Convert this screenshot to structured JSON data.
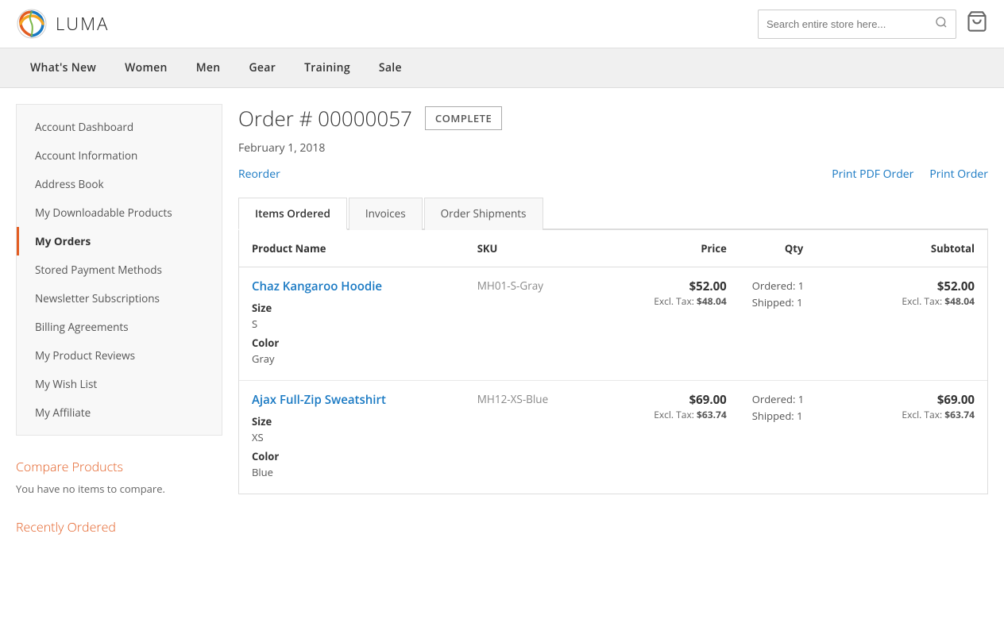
{
  "header": {
    "logo_text": "LUMA",
    "search_placeholder": "Search entire store here...",
    "cart_label": "Cart"
  },
  "nav": {
    "items": [
      {
        "label": "What's New",
        "id": "whats-new"
      },
      {
        "label": "Women",
        "id": "women"
      },
      {
        "label": "Men",
        "id": "men"
      },
      {
        "label": "Gear",
        "id": "gear"
      },
      {
        "label": "Training",
        "id": "training"
      },
      {
        "label": "Sale",
        "id": "sale"
      }
    ]
  },
  "sidebar": {
    "nav_items": [
      {
        "label": "Account Dashboard",
        "active": false
      },
      {
        "label": "Account Information",
        "active": false
      },
      {
        "label": "Address Book",
        "active": false
      },
      {
        "label": "My Downloadable Products",
        "active": false
      },
      {
        "label": "My Orders",
        "active": true
      },
      {
        "label": "Stored Payment Methods",
        "active": false
      },
      {
        "label": "Newsletter Subscriptions",
        "active": false
      },
      {
        "label": "Billing Agreements",
        "active": false
      },
      {
        "label": "My Product Reviews",
        "active": false
      },
      {
        "label": "My Wish List",
        "active": false
      },
      {
        "label": "My Affiliate",
        "active": false
      }
    ],
    "compare_title_part1": "Compare",
    "compare_title_part2": "Products",
    "compare_empty": "You have no items to compare.",
    "recently_ordered_title": "Recently Ordered"
  },
  "order": {
    "title": "Order # 00000057",
    "status": "COMPLETE",
    "date": "February 1, 2018",
    "reorder_label": "Reorder",
    "print_pdf_label": "Print PDF Order",
    "print_order_label": "Print Order"
  },
  "tabs": [
    {
      "label": "Items Ordered",
      "active": true
    },
    {
      "label": "Invoices",
      "active": false
    },
    {
      "label": "Order Shipments",
      "active": false
    }
  ],
  "table": {
    "columns": [
      {
        "label": "Product Name",
        "align": "left"
      },
      {
        "label": "SKU",
        "align": "left"
      },
      {
        "label": "Price",
        "align": "right"
      },
      {
        "label": "Qty",
        "align": "center"
      },
      {
        "label": "Subtotal",
        "align": "right"
      }
    ],
    "rows": [
      {
        "product_name": "Chaz Kangaroo Hoodie",
        "sku": "MH01-S-Gray",
        "price": "$52.00",
        "price_excl_label": "Excl. Tax:",
        "price_excl": "$48.04",
        "qty_ordered": "Ordered: 1",
        "qty_shipped": "Shipped: 1",
        "subtotal": "$52.00",
        "subtotal_excl_label": "Excl. Tax:",
        "subtotal_excl": "$48.04",
        "size_label": "Size",
        "size_value": "S",
        "color_label": "Color",
        "color_value": "Gray"
      },
      {
        "product_name": "Ajax Full-Zip Sweatshirt",
        "sku": "MH12-XS-Blue",
        "price": "$69.00",
        "price_excl_label": "Excl. Tax:",
        "price_excl": "$63.74",
        "qty_ordered": "Ordered: 1",
        "qty_shipped": "Shipped: 1",
        "subtotal": "$69.00",
        "subtotal_excl_label": "Excl. Tax:",
        "subtotal_excl": "$63.74",
        "size_label": "Size",
        "size_value": "XS",
        "color_label": "Color",
        "color_value": "Blue"
      }
    ]
  }
}
